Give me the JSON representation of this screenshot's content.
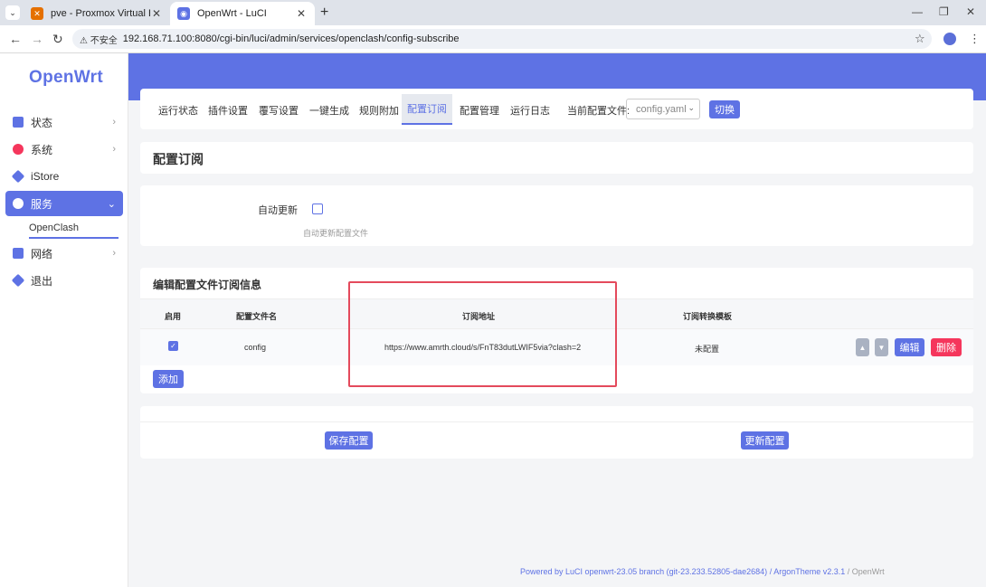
{
  "browser": {
    "tabs": [
      {
        "title": "pve - Proxmox Virtual Environ",
        "favicon": "proxmox-icon",
        "active": false
      },
      {
        "title": "OpenWrt - LuCI",
        "favicon": "openwrt-icon",
        "active": true
      }
    ],
    "new_tab": "+",
    "insecure_label": "不安全",
    "url": "192.168.71.100:8080/cgi-bin/luci/admin/services/openclash/config-subscribe"
  },
  "sidebar": {
    "logo": "OpenWrt",
    "items": [
      {
        "label": "状态",
        "icon": "dashboard-icon",
        "color": "#5e72e4"
      },
      {
        "label": "系统",
        "icon": "gear-icon",
        "color": "#f5365c"
      },
      {
        "label": "iStore",
        "icon": "cube-icon",
        "color": "#5e72e4"
      },
      {
        "label": "服务",
        "icon": "services-icon",
        "color": "#ffffff"
      },
      {
        "label": "网络",
        "icon": "network-icon",
        "color": "#5e72e4"
      },
      {
        "label": "退出",
        "icon": "logout-icon",
        "color": "#5e72e4"
      }
    ],
    "submenu": "OpenClash"
  },
  "tabs": [
    "运行状态",
    "插件设置",
    "覆写设置",
    "一键生成",
    "规则附加",
    "配置订阅",
    "配置管理",
    "运行日志"
  ],
  "active_tab": "配置订阅",
  "config": {
    "label": "当前配置文件:",
    "selected": "config.yaml",
    "switch_button": "切换"
  },
  "page_title": "配置订阅",
  "auto_update": {
    "label": "自动更新",
    "checked": false,
    "description": "自动更新配置文件"
  },
  "subscription": {
    "title": "编辑配置文件订阅信息",
    "columns": [
      "启用",
      "配置文件名",
      "订阅地址",
      "订阅转换模板"
    ],
    "rows": [
      {
        "enabled": true,
        "name": "config",
        "url": "https://www.amrth.cloud/s/FnT83dutLWIF5via?clash=2",
        "template": "未配置"
      }
    ],
    "edit_button": "编辑",
    "delete_button": "删除",
    "add_button": "添加"
  },
  "actions": {
    "save": "保存配置",
    "update": "更新配置"
  },
  "footer": {
    "luci": "Powered by LuCI openwrt-23.05 branch (git-23.233.52805-dae2684)",
    "theme": " / ArgonTheme v2.3.1",
    "tail": " / OpenWrt"
  },
  "colors": {
    "accent": "#5e72e4",
    "danger": "#f5365c",
    "highlight": "#e44a5c"
  }
}
